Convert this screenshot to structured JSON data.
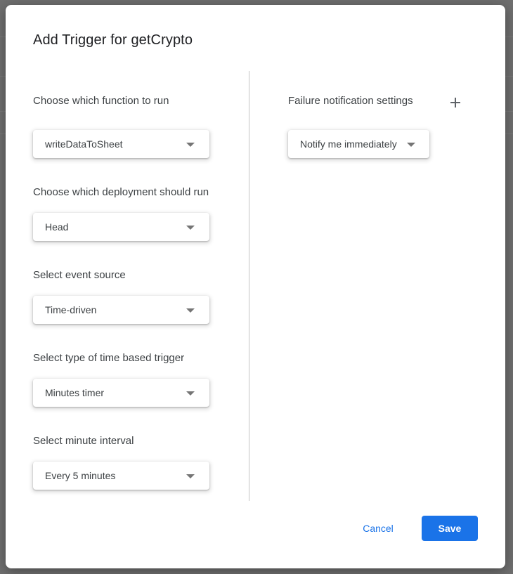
{
  "dialog": {
    "title": "Add Trigger for getCrypto"
  },
  "left_column": {
    "fields": [
      {
        "label": "Choose which function to run",
        "value": "writeDataToSheet"
      },
      {
        "label": "Choose which deployment should run",
        "value": "Head"
      },
      {
        "label": "Select event source",
        "value": "Time-driven"
      },
      {
        "label": "Select type of time based trigger",
        "value": "Minutes timer"
      },
      {
        "label": "Select minute interval",
        "value": "Every 5 minutes"
      }
    ]
  },
  "right_column": {
    "failure_label": "Failure notification settings",
    "failure_value": "Notify me immediately",
    "add_icon": "plus-icon"
  },
  "actions": {
    "cancel_label": "Cancel",
    "save_label": "Save"
  },
  "colors": {
    "primary": "#1a73e8",
    "text": "#3c4043",
    "title": "#202124",
    "scrim": "#6f6f6f"
  }
}
